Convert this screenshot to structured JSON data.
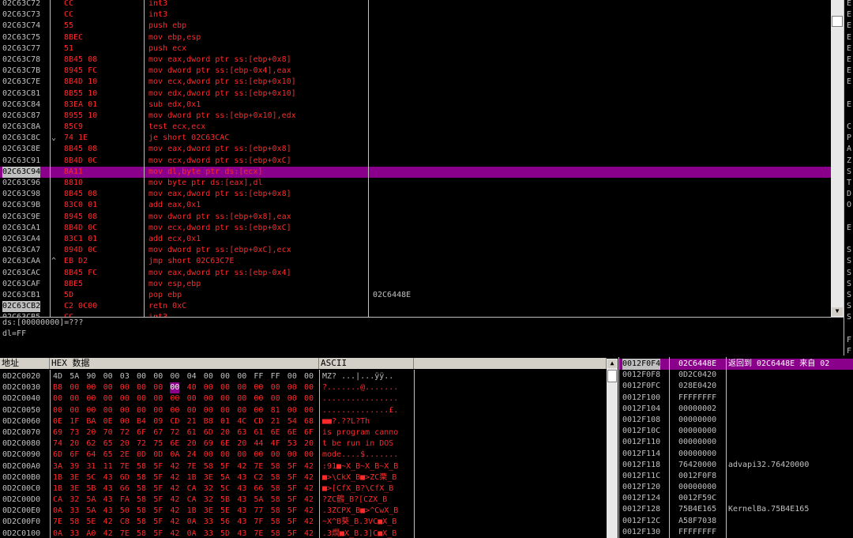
{
  "disasm": {
    "rows": [
      {
        "addr": "02C63C72",
        "mark": "",
        "hex": "CC",
        "cmd": "int3",
        "sel": false,
        "hl": false
      },
      {
        "addr": "02C63C73",
        "mark": "",
        "hex": "CC",
        "cmd": "int3",
        "sel": false,
        "hl": false
      },
      {
        "addr": "02C63C74",
        "mark": "",
        "hex": "55",
        "cmd": "push ebp",
        "sel": false,
        "hl": false
      },
      {
        "addr": "02C63C75",
        "mark": "",
        "hex": "8BEC",
        "cmd": "mov ebp,esp",
        "sel": false,
        "hl": false
      },
      {
        "addr": "02C63C77",
        "mark": "",
        "hex": "51",
        "cmd": "push ecx",
        "sel": false,
        "hl": false
      },
      {
        "addr": "02C63C78",
        "mark": "",
        "hex": "8B45 08",
        "cmd": "mov eax,dword ptr ss:[ebp+0x8]",
        "sel": false,
        "hl": false
      },
      {
        "addr": "02C63C7B",
        "mark": "",
        "hex": "8945 FC",
        "cmd": "mov dword ptr ss:[ebp-0x4],eax",
        "sel": false,
        "hl": false
      },
      {
        "addr": "02C63C7E",
        "mark": "",
        "hex": "8B4D 10",
        "cmd": "mov ecx,dword ptr ss:[ebp+0x10]",
        "sel": false,
        "hl": false
      },
      {
        "addr": "02C63C81",
        "mark": "",
        "hex": "8B55 10",
        "cmd": "mov edx,dword ptr ss:[ebp+0x10]",
        "sel": false,
        "hl": false
      },
      {
        "addr": "02C63C84",
        "mark": "",
        "hex": "83EA 01",
        "cmd": "sub edx,0x1",
        "sel": false,
        "hl": false
      },
      {
        "addr": "02C63C87",
        "mark": "",
        "hex": "8955 10",
        "cmd": "mov dword ptr ss:[ebp+0x10],edx",
        "sel": false,
        "hl": false
      },
      {
        "addr": "02C63C8A",
        "mark": "",
        "hex": "85C9",
        "cmd": "test ecx,ecx",
        "sel": false,
        "hl": false
      },
      {
        "addr": "02C63C8C",
        "mark": "⌄",
        "hex": "74 1E",
        "cmd": "je short 02C63CAC",
        "sel": false,
        "hl": false
      },
      {
        "addr": "02C63C8E",
        "mark": "",
        "hex": "8B45 08",
        "cmd": "mov eax,dword ptr ss:[ebp+0x8]",
        "sel": false,
        "hl": false
      },
      {
        "addr": "02C63C91",
        "mark": "",
        "hex": "8B4D 0C",
        "cmd": "mov ecx,dword ptr ss:[ebp+0xC]",
        "sel": false,
        "hl": false
      },
      {
        "addr": "02C63C94",
        "mark": "",
        "hex": "8A11",
        "cmd": "mov dl,byte ptr ds:[ecx]",
        "sel": true,
        "hl": true
      },
      {
        "addr": "02C63C96",
        "mark": "",
        "hex": "8810",
        "cmd": "mov byte ptr ds:[eax],dl",
        "sel": false,
        "hl": false
      },
      {
        "addr": "02C63C98",
        "mark": "",
        "hex": "8B45 08",
        "cmd": "mov eax,dword ptr ss:[ebp+0x8]",
        "sel": false,
        "hl": false
      },
      {
        "addr": "02C63C9B",
        "mark": "",
        "hex": "83C0 01",
        "cmd": "add eax,0x1",
        "sel": false,
        "hl": false
      },
      {
        "addr": "02C63C9E",
        "mark": "",
        "hex": "8945 08",
        "cmd": "mov dword ptr ss:[ebp+0x8],eax",
        "sel": false,
        "hl": false
      },
      {
        "addr": "02C63CA1",
        "mark": "",
        "hex": "8B4D 0C",
        "cmd": "mov ecx,dword ptr ss:[ebp+0xC]",
        "sel": false,
        "hl": false
      },
      {
        "addr": "02C63CA4",
        "mark": "",
        "hex": "83C1 01",
        "cmd": "add ecx,0x1",
        "sel": false,
        "hl": false
      },
      {
        "addr": "02C63CA7",
        "mark": "",
        "hex": "894D 0C",
        "cmd": "mov dword ptr ss:[ebp+0xC],ecx",
        "sel": false,
        "hl": false
      },
      {
        "addr": "02C63CAA",
        "mark": "^",
        "hex": "EB D2",
        "cmd": "jmp short 02C63C7E",
        "sel": false,
        "hl": false
      },
      {
        "addr": "02C63CAC",
        "mark": "",
        "hex": "8B45 FC",
        "cmd": "mov eax,dword ptr ss:[ebp-0x4]",
        "sel": false,
        "hl": false
      },
      {
        "addr": "02C63CAF",
        "mark": "",
        "hex": "8BE5",
        "cmd": "mov esp,ebp",
        "sel": false,
        "hl": false
      },
      {
        "addr": "02C63CB1",
        "mark": "",
        "hex": "5D",
        "cmd": "pop ebp",
        "sel": false,
        "hl": false
      },
      {
        "addr": "02C63CB2",
        "mark": "",
        "hex": "C2 0C00",
        "cmd": "retn 0xC",
        "sel": true,
        "hl": false
      },
      {
        "addr": "02C63CB5",
        "mark": "",
        "hex": "CC",
        "cmd": "int3",
        "sel": false,
        "hl": false
      }
    ],
    "comment_rows": [
      {
        "row": 26,
        "text": "02C6448E"
      }
    ]
  },
  "info": {
    "line1": "ds:[00000000]=???",
    "line2": "dl=FF"
  },
  "right_edge_letters": [
    "E",
    "E",
    "E",
    "E",
    "E",
    "E",
    "E",
    "E",
    "",
    "E",
    "",
    "C",
    "P",
    "A",
    "Z",
    "S",
    "T",
    "D",
    "O",
    "",
    "E",
    "",
    "S",
    "S",
    "S",
    "S",
    "S",
    "S",
    "S",
    "",
    "F",
    "F"
  ],
  "hex_dump": {
    "headers": {
      "address": "地址",
      "hex": "HEX 数据",
      "ascii": "ASCII"
    },
    "rows": [
      {
        "addr": "0D2C0020",
        "b": [
          "4D",
          "5A",
          "90",
          "00",
          "03",
          "00",
          "00",
          "00",
          "04",
          "00",
          "00",
          "00",
          "FF",
          "FF",
          "00",
          "00"
        ],
        "ascii": "MZ? ...|...ÿÿ..",
        "mark": -1
      },
      {
        "addr": "0D2C0030",
        "b": [
          "B8",
          "00",
          "00",
          "00",
          "00",
          "00",
          "00",
          "00",
          "40",
          "00",
          "00",
          "00",
          "00",
          "00",
          "00",
          "00"
        ],
        "ascii": "?.......@.......",
        "mark": 7
      },
      {
        "addr": "0D2C0040",
        "b": [
          "00",
          "00",
          "00",
          "00",
          "00",
          "00",
          "00",
          "00",
          "00",
          "00",
          "00",
          "00",
          "00",
          "00",
          "00",
          "00"
        ],
        "ascii": "................",
        "mark": -1
      },
      {
        "addr": "0D2C0050",
        "b": [
          "00",
          "00",
          "00",
          "00",
          "00",
          "00",
          "00",
          "00",
          "00",
          "00",
          "00",
          "00",
          "00",
          "81",
          "00",
          "00"
        ],
        "ascii": "..............£.",
        "mark": -1
      },
      {
        "addr": "0D2C0060",
        "b": [
          "0E",
          "1F",
          "BA",
          "0E",
          "00",
          "B4",
          "09",
          "CD",
          "21",
          "B8",
          "01",
          "4C",
          "CD",
          "21",
          "54",
          "68"
        ],
        "ascii": "■■?.??L?Th",
        "mark": -1
      },
      {
        "addr": "0D2C0070",
        "b": [
          "69",
          "73",
          "20",
          "70",
          "72",
          "6F",
          "67",
          "72",
          "61",
          "6D",
          "20",
          "63",
          "61",
          "6E",
          "6E",
          "6F"
        ],
        "ascii": "is program canno",
        "mark": -1
      },
      {
        "addr": "0D2C0080",
        "b": [
          "74",
          "20",
          "62",
          "65",
          "20",
          "72",
          "75",
          "6E",
          "20",
          "69",
          "6E",
          "20",
          "44",
          "4F",
          "53",
          "20"
        ],
        "ascii": "t be run in DOS ",
        "mark": -1
      },
      {
        "addr": "0D2C0090",
        "b": [
          "6D",
          "6F",
          "64",
          "65",
          "2E",
          "0D",
          "0D",
          "0A",
          "24",
          "00",
          "00",
          "00",
          "00",
          "00",
          "00",
          "00"
        ],
        "ascii": "mode....$.......",
        "mark": -1
      },
      {
        "addr": "0D2C00A0",
        "b": [
          "3A",
          "39",
          "31",
          "11",
          "7E",
          "58",
          "5F",
          "42",
          "7E",
          "58",
          "5F",
          "42",
          "7E",
          "58",
          "5F",
          "42"
        ],
        "ascii": ":91■~X_B~X_B~X_B",
        "mark": -1
      },
      {
        "addr": "0D2C00B0",
        "b": [
          "1B",
          "3E",
          "5C",
          "43",
          "6D",
          "58",
          "5F",
          "42",
          "1B",
          "3E",
          "5A",
          "43",
          "C2",
          "58",
          "5F",
          "42"
        ],
        "ascii": "■>\\CkX_B■>ZC栗_B",
        "mark": -1
      },
      {
        "addr": "0D2C00C0",
        "b": [
          "1B",
          "3E",
          "5B",
          "43",
          "66",
          "58",
          "5F",
          "42",
          "CA",
          "32",
          "5C",
          "43",
          "66",
          "58",
          "5F",
          "42"
        ],
        "ascii": "■>[CfX_B?\\CfX_B",
        "mark": -1
      },
      {
        "addr": "0D2C00D0",
        "b": [
          "CA",
          "32",
          "5A",
          "43",
          "FA",
          "58",
          "5F",
          "42",
          "CA",
          "32",
          "5B",
          "43",
          "5A",
          "58",
          "5F",
          "42"
        ],
        "ascii": "?ZC鶴_B?[CZX_B",
        "mark": -1
      },
      {
        "addr": "0D2C00E0",
        "b": [
          "0A",
          "33",
          "5A",
          "43",
          "50",
          "58",
          "5F",
          "42",
          "1B",
          "3E",
          "5E",
          "43",
          "77",
          "58",
          "5F",
          "42"
        ],
        "ascii": ".3ZCPX_B■>^CwX_B",
        "mark": -1
      },
      {
        "addr": "0D2C00F0",
        "b": [
          "7E",
          "58",
          "5E",
          "42",
          "C8",
          "58",
          "5F",
          "42",
          "0A",
          "33",
          "56",
          "43",
          "7F",
          "58",
          "5F",
          "42"
        ],
        "ascii": "~X^B葵_B.3VC■X_B",
        "mark": -1
      },
      {
        "addr": "0D2C0100",
        "b": [
          "0A",
          "33",
          "A0",
          "42",
          "7E",
          "58",
          "5F",
          "42",
          "0A",
          "33",
          "5D",
          "43",
          "7E",
          "58",
          "5F",
          "42"
        ],
        "ascii": ".3燗■X_B.3]C■X_B",
        "mark": -1
      }
    ]
  },
  "stack": {
    "rows": [
      {
        "addr": "0012F0F4",
        "val": "02C6448E",
        "comment": "返回到 02C6448E 来自 02",
        "sel": true
      },
      {
        "addr": "0012F0F8",
        "val": "0D2C0420",
        "comment": "",
        "sel": false
      },
      {
        "addr": "0012F0FC",
        "val": "028E0420",
        "comment": "",
        "sel": false
      },
      {
        "addr": "0012F100",
        "val": "FFFFFFFF",
        "comment": "",
        "sel": false
      },
      {
        "addr": "0012F104",
        "val": "00000002",
        "comment": "",
        "sel": false
      },
      {
        "addr": "0012F108",
        "val": "00000000",
        "comment": "",
        "sel": false
      },
      {
        "addr": "0012F10C",
        "val": "00000000",
        "comment": "",
        "sel": false
      },
      {
        "addr": "0012F110",
        "val": "00000000",
        "comment": "",
        "sel": false
      },
      {
        "addr": "0012F114",
        "val": "00000000",
        "comment": "",
        "sel": false
      },
      {
        "addr": "0012F118",
        "val": "76420000",
        "comment": "advapi32.76420000",
        "sel": false
      },
      {
        "addr": "0012F11C",
        "val": "0012F0F8",
        "comment": "",
        "sel": false
      },
      {
        "addr": "0012F120",
        "val": "00000000",
        "comment": "",
        "sel": false
      },
      {
        "addr": "0012F124",
        "val": "0012F59C",
        "comment": "",
        "sel": false
      },
      {
        "addr": "0012F128",
        "val": "75B4E165",
        "comment": "KernelBa.75B4E165",
        "sel": false
      },
      {
        "addr": "0012F12C",
        "val": "A58F7038",
        "comment": "",
        "sel": false
      },
      {
        "addr": "0012F130",
        "val": "FFFFFFFF",
        "comment": "",
        "sel": false
      }
    ]
  },
  "colors": {
    "red": "#ff2a2a",
    "highlight": "#8b008b",
    "sel_addr_bg": "#c0c0c0"
  },
  "icons": {
    "scroll_up": "▲",
    "scroll_down": "▼"
  }
}
